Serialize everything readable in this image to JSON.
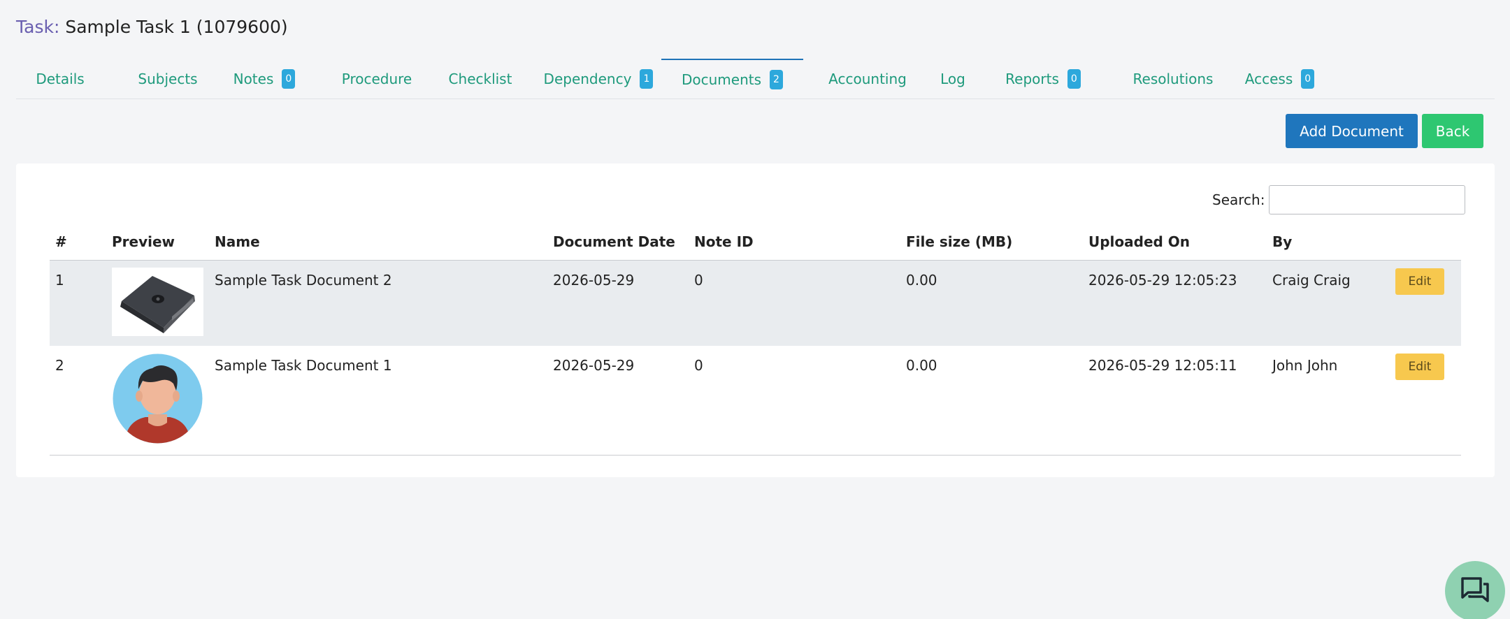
{
  "header": {
    "label": "Task:",
    "title": "Sample Task 1 (1079600)"
  },
  "tabs": [
    {
      "label": "Details"
    },
    {
      "label": "Subjects"
    },
    {
      "label": "Notes",
      "badge": "0"
    },
    {
      "label": "Procedure"
    },
    {
      "label": "Checklist"
    },
    {
      "label": "Dependency",
      "badge": "1"
    },
    {
      "label": "Documents",
      "badge": "2",
      "active": true
    },
    {
      "label": "Accounting"
    },
    {
      "label": "Log"
    },
    {
      "label": "Reports",
      "badge": "0"
    },
    {
      "label": "Resolutions"
    },
    {
      "label": "Access",
      "badge": "0"
    }
  ],
  "actions": {
    "add_label": "Add Document",
    "back_label": "Back"
  },
  "search": {
    "label": "Search:",
    "value": ""
  },
  "table": {
    "headers": [
      "#",
      "Preview",
      "Name",
      "Document Date",
      "Note ID",
      "File size (MB)",
      "Uploaded On",
      "By",
      ""
    ],
    "rows": [
      {
        "num": "1",
        "preview": "device-thumbnail",
        "name": "Sample Task Document 2",
        "date": "2026-05-29",
        "note_id": "0",
        "size": "0.00",
        "uploaded": "2026-05-29 12:05:23",
        "by": "Craig Craig",
        "edit": "Edit"
      },
      {
        "num": "2",
        "preview": "avatar-thumbnail",
        "name": "Sample Task Document 1",
        "date": "2026-05-29",
        "note_id": "0",
        "size": "0.00",
        "uploaded": "2026-05-29 12:05:11",
        "by": "John John",
        "edit": "Edit"
      }
    ]
  },
  "colors": {
    "accent": "#1e9a7c",
    "primary": "#1f76bd",
    "success": "#2ec771",
    "warning": "#f7c84e",
    "badge": "#2da8dc"
  },
  "icons": {
    "chat": "chat-bubbles-icon"
  }
}
